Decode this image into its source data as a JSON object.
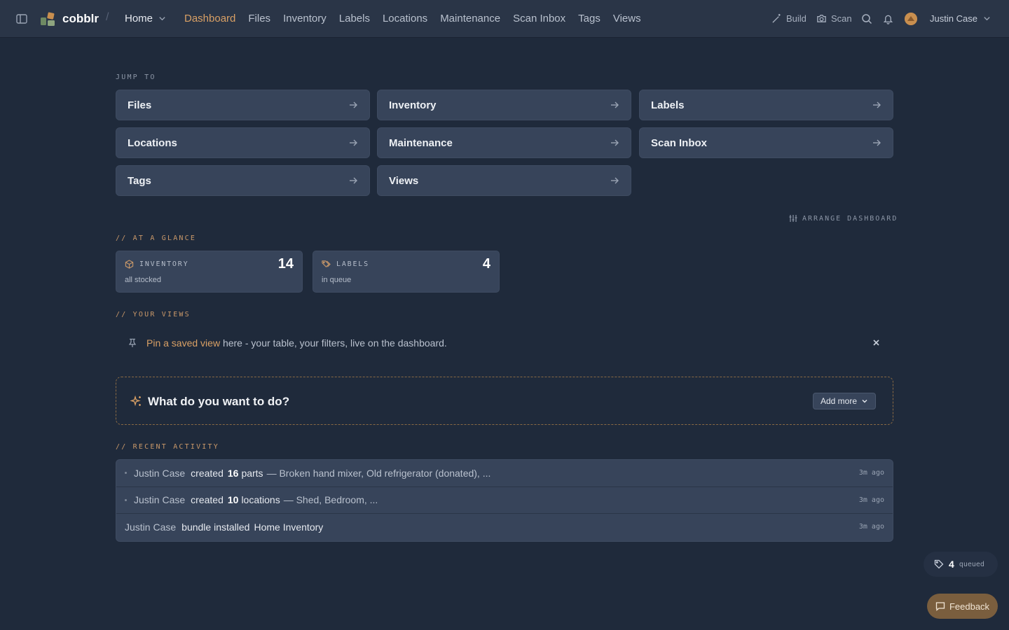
{
  "header": {
    "brand": "cobblr",
    "separator": "/",
    "workspace": "Home",
    "nav": [
      "Dashboard",
      "Files",
      "Inventory",
      "Labels",
      "Locations",
      "Maintenance",
      "Scan Inbox",
      "Tags",
      "Views"
    ],
    "active_nav": "Dashboard",
    "build_label": "Build",
    "scan_label": "Scan",
    "user_name": "Justin Case"
  },
  "jump_to": {
    "label": "JUMP TO",
    "tiles": [
      "Files",
      "Inventory",
      "Labels",
      "Locations",
      "Maintenance",
      "Scan Inbox",
      "Tags",
      "Views"
    ]
  },
  "arrange_label": "ARRANGE DASHBOARD",
  "glance": {
    "label": "// AT A GLANCE",
    "cards": [
      {
        "title": "INVENTORY",
        "value": "14",
        "sub": "all stocked",
        "icon": "box-icon"
      },
      {
        "title": "LABELS",
        "value": "4",
        "sub": "in queue",
        "icon": "tags-icon"
      }
    ]
  },
  "views": {
    "label": "// YOUR VIEWS",
    "link_text": "Pin a saved view",
    "rest_text": " here - your table, your filters, live on the dashboard."
  },
  "todo": {
    "title": "What do you want to do?",
    "add_more_label": "Add more"
  },
  "activity": {
    "label": "// RECENT ACTIVITY",
    "rows": [
      {
        "who": "Justin Case",
        "verb": "created",
        "count": "16",
        "noun": "parts",
        "rest": "— Broken hand mixer, Old refrigerator (donated), ...",
        "when": "3m ago",
        "dot": true
      },
      {
        "who": "Justin Case",
        "verb": "created",
        "count": "10",
        "noun": "locations",
        "rest": "— Shed, Bedroom, ...",
        "when": "3m ago",
        "dot": true
      },
      {
        "who": "Justin Case",
        "verb": "bundle installed",
        "count": "",
        "noun": "Home Inventory",
        "rest": "",
        "when": "3m ago",
        "dot": false
      }
    ]
  },
  "queued": {
    "count": "4",
    "label": "queued"
  },
  "feedback_label": "Feedback",
  "colors": {
    "accent": "#d9a065",
    "background": "#1f2a3b",
    "card": "#37445a"
  }
}
